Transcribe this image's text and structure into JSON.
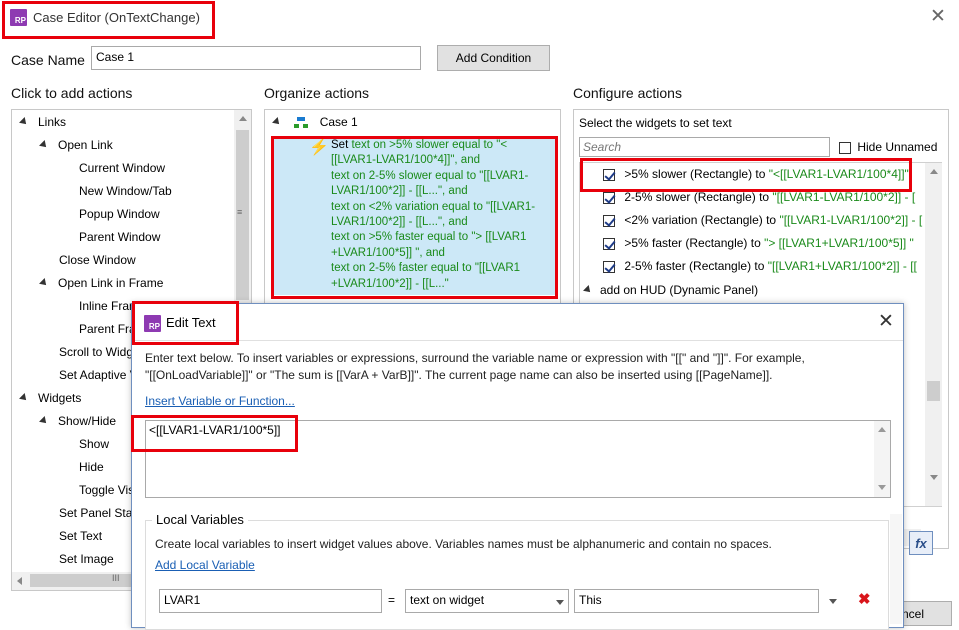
{
  "window": {
    "title": "Case Editor (OnTextChange)",
    "logo_text": "RP"
  },
  "case_name": {
    "label": "Case Name",
    "value": "Case 1",
    "add_condition_label": "Add Condition"
  },
  "left_panel": {
    "heading": "Click to add actions",
    "items": [
      {
        "label": "Links"
      },
      {
        "label": "Open Link"
      },
      {
        "label": "Current Window"
      },
      {
        "label": "New Window/Tab"
      },
      {
        "label": "Popup Window"
      },
      {
        "label": "Parent Window"
      },
      {
        "label": "Close Window"
      },
      {
        "label": "Open Link in Frame"
      },
      {
        "label": "Inline Fran"
      },
      {
        "label": "Parent Fra"
      },
      {
        "label": "Scroll to Widg"
      },
      {
        "label": "Set Adaptive V"
      },
      {
        "label": "Widgets"
      },
      {
        "label": "Show/Hide"
      },
      {
        "label": "Show"
      },
      {
        "label": "Hide"
      },
      {
        "label": "Toggle Vis"
      },
      {
        "label": "Set Panel Stat"
      },
      {
        "label": "Set Text"
      },
      {
        "label": "Set Image"
      }
    ]
  },
  "middle_panel": {
    "heading": "Organize actions",
    "case_label": "Case 1",
    "action_lines": [
      [
        "Set ",
        "text on >5% slower equal to \"<"
      ],
      [
        "",
        "[[LVAR1-LVAR1/100*4]]\", and"
      ],
      [
        "",
        " text on 2-5% slower equal to \"[[LVAR1-"
      ],
      [
        "",
        "LVAR1/100*2]] - [[L...\", and"
      ],
      [
        "",
        " text on <2% variation equal to \"[[LVAR1-"
      ],
      [
        "",
        "LVAR1/100*2]] - [[L...\", and"
      ],
      [
        "",
        " text on >5% faster equal to \"> [[LVAR1"
      ],
      [
        "",
        "+LVAR1/100*5]] \", and"
      ],
      [
        "",
        " text on 2-5% faster equal to \"[[LVAR1"
      ],
      [
        "",
        "+LVAR1/100*2]] - [[L...\""
      ]
    ]
  },
  "right_panel": {
    "heading": "Configure actions",
    "subheading": "Select the widgets to set text",
    "search_placeholder": "Search",
    "hide_unnamed_label": "Hide Unnamed",
    "widgets": [
      {
        "name": ">5% slower (Rectangle) to ",
        "value": "\"<[[LVAR1-LVAR1/100*4]]\""
      },
      {
        "name": "2-5% slower (Rectangle) to ",
        "value": "\"[[LVAR1-LVAR1/100*2]] - ["
      },
      {
        "name": "<2% variation (Rectangle) to ",
        "value": "\"[[LVAR1-LVAR1/100*2]] - ["
      },
      {
        "name": ">5% faster (Rectangle) to ",
        "value": "\"> [[LVAR1+LVAR1/100*5]] \""
      },
      {
        "name": "2-5% faster (Rectangle) to ",
        "value": "\"[[LVAR1+LVAR1/100*2]] - [["
      }
    ],
    "hud_label": "add on HUD (Dynamic Panel)",
    "fx_label": "fx",
    "cancel_partial": "ncel"
  },
  "edit_text": {
    "title": "Edit Text",
    "logo_text": "RP",
    "instructions": "Enter text below. To insert variables or expressions, surround the variable name or expression with \"[[\" and \"]]\". For example,",
    "instructions2": "\"[[OnLoadVariable]]\" or \"The sum is [[VarA + VarB]]\". The current page name can also be inserted using [[PageName]].",
    "insert_link": "Insert Variable or Function...",
    "text_value": "<[[LVAR1-LVAR1/100*5]]",
    "local_vars_title": "Local Variables",
    "local_vars_desc": "Create local variables to insert widget values above. Variables names must be alphanumeric and contain no spaces.",
    "add_local_link": "Add Local Variable",
    "var_name": "LVAR1",
    "equals": "=",
    "var_type": "text on widget",
    "var_target": "This",
    "delete_glyph": "✖"
  },
  "colors": {
    "highlight_red": "#e8000b",
    "selection_blue": "#cce8f7",
    "action_green": "#1a8a1a",
    "logo_purple": "#8e3ab2"
  }
}
